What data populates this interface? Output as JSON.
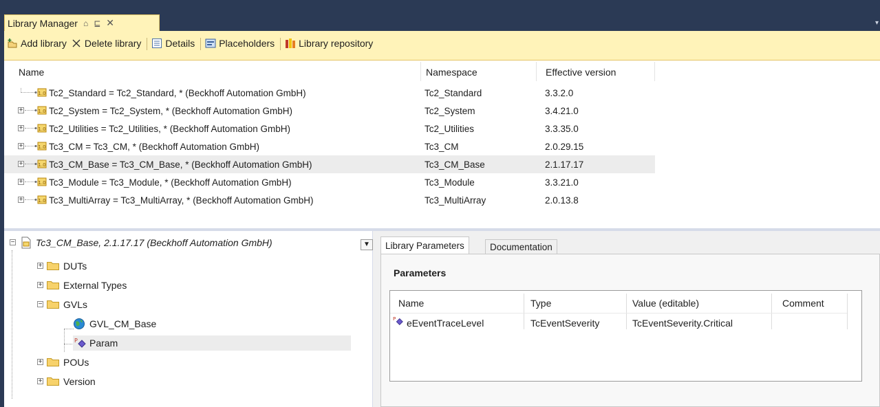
{
  "window": {
    "title": "Library Manager",
    "pin_glyph": "⌂",
    "autohide_glyph": "⊑",
    "close_glyph": "✕",
    "dropdown_glyph": "▾"
  },
  "toolbar": {
    "add_label": "Add library",
    "delete_label": "Delete library",
    "details_label": "Details",
    "placeholders_label": "Placeholders",
    "repository_label": "Library repository"
  },
  "library_table": {
    "headers": {
      "name": "Name",
      "namespace": "Namespace",
      "version": "Effective version"
    },
    "rows": [
      {
        "name": "Tc2_Standard = Tc2_Standard, * (Beckhoff Automation GmbH)",
        "namespace": "Tc2_Standard",
        "version": "3.3.2.0",
        "expandable": false
      },
      {
        "name": "Tc2_System = Tc2_System, * (Beckhoff Automation GmbH)",
        "namespace": "Tc2_System",
        "version": "3.4.21.0",
        "expandable": true
      },
      {
        "name": "Tc2_Utilities = Tc2_Utilities, * (Beckhoff Automation GmbH)",
        "namespace": "Tc2_Utilities",
        "version": "3.3.35.0",
        "expandable": true
      },
      {
        "name": "Tc3_CM = Tc3_CM, * (Beckhoff Automation GmbH)",
        "namespace": "Tc3_CM",
        "version": "2.0.29.15",
        "expandable": true
      },
      {
        "name": "Tc3_CM_Base = Tc3_CM_Base, * (Beckhoff Automation GmbH)",
        "namespace": "Tc3_CM_Base",
        "version": "2.1.17.17",
        "expandable": true,
        "selected": true
      },
      {
        "name": "Tc3_Module = Tc3_Module, * (Beckhoff Automation GmbH)",
        "namespace": "Tc3_Module",
        "version": "3.3.21.0",
        "expandable": true
      },
      {
        "name": "Tc3_MultiArray = Tc3_MultiArray, * (Beckhoff Automation GmbH)",
        "namespace": "Tc3_MultiArray",
        "version": "2.0.13.8",
        "expandable": true
      }
    ]
  },
  "tree": {
    "root_label": "Tc3_CM_Base, 2.1.17.17 (Beckhoff Automation GmbH)",
    "nodes": {
      "duts": "DUTs",
      "external_types": "External Types",
      "gvls": "GVLs",
      "gvl_cm_base": "GVL_CM_Base",
      "param": "Param",
      "pous": "POUs",
      "version": "Version"
    }
  },
  "right_panel": {
    "tabs": [
      "Library Parameters",
      "Documentation"
    ],
    "section_title": "Parameters",
    "grid": {
      "headers": {
        "name": "Name",
        "type": "Type",
        "value": "Value (editable)",
        "comment": "Comment"
      },
      "rows": [
        {
          "name": "eEventTraceLevel",
          "type": "TcEventSeverity",
          "value": "TcEventSeverity.Critical",
          "comment": ""
        }
      ]
    }
  },
  "colors": {
    "frame": "#2b3a55",
    "toolbar_bg": "#fff3b9",
    "selection": "#ececec"
  }
}
